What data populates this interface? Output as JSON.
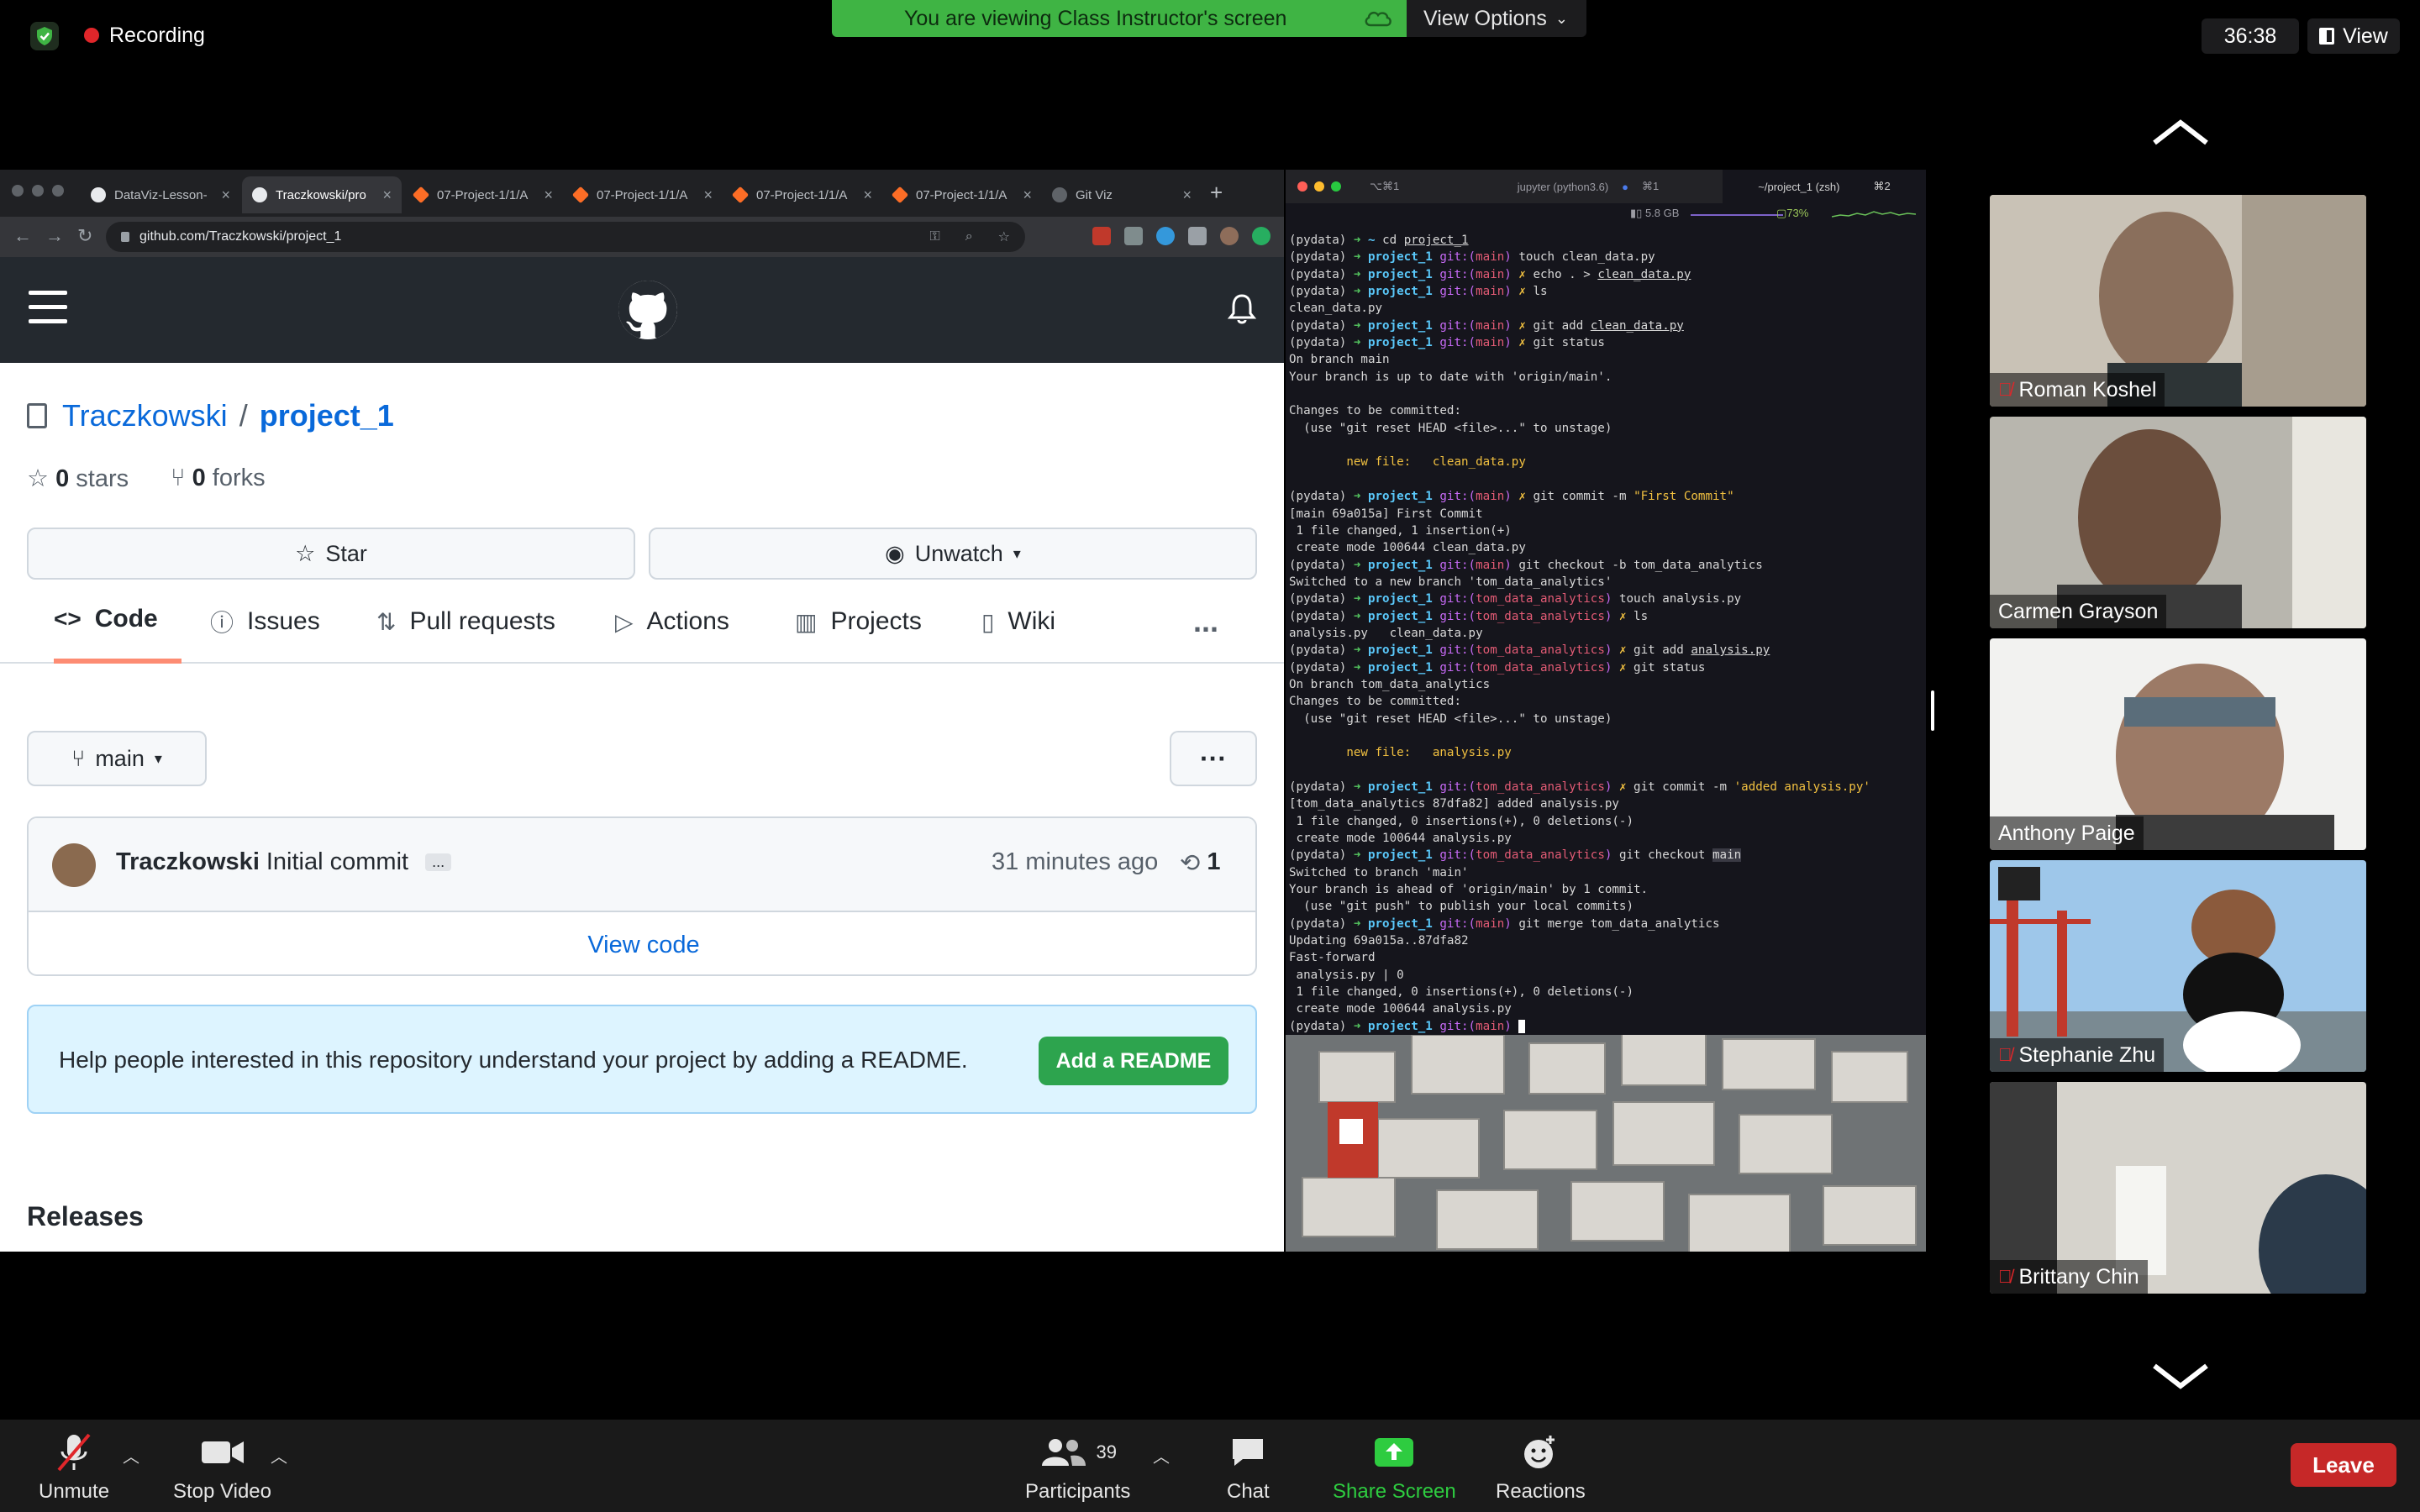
{
  "zoom": {
    "recording_label": "Recording",
    "viewing_banner": "You are viewing Class Instructor's screen",
    "view_options_label": "View Options",
    "timer": "36:38",
    "view_label": "View",
    "bottom": {
      "unmute": "Unmute",
      "stop_video": "Stop Video",
      "participants": "Participants",
      "participants_count": "39",
      "chat": "Chat",
      "share_screen": "Share Screen",
      "reactions": "Reactions",
      "leave": "Leave"
    },
    "participants_list": [
      {
        "name": "Roman Koshel",
        "muted": true
      },
      {
        "name": "Carmen Grayson",
        "muted": false
      },
      {
        "name": "Anthony Paige",
        "muted": false
      },
      {
        "name": "Stephanie Zhu",
        "muted": true
      },
      {
        "name": "Brittany Chin",
        "muted": true
      }
    ]
  },
  "browser": {
    "tabs": [
      {
        "title": "DataViz-Lesson-",
        "favicon": "github-icon"
      },
      {
        "title": "Traczkowski/pro",
        "favicon": "github-icon"
      },
      {
        "title": "07-Project-1/1/A",
        "favicon": "gitlab-icon"
      },
      {
        "title": "07-Project-1/1/A",
        "favicon": "gitlab-icon"
      },
      {
        "title": "07-Project-1/1/A",
        "favicon": "gitlab-icon"
      },
      {
        "title": "07-Project-1/1/A",
        "favicon": "gitlab-icon"
      },
      {
        "title": "Git Viz",
        "favicon": "globe-icon"
      }
    ],
    "url": "github.com/Traczkowski/project_1"
  },
  "github": {
    "owner": "Traczkowski",
    "separator": "/",
    "repo": "project_1",
    "stars_count": "0",
    "stars_label": "stars",
    "forks_count": "0",
    "forks_label": "forks",
    "star_button": "Star",
    "unwatch_button": "Unwatch",
    "tabs": [
      "Code",
      "Issues",
      "Pull requests",
      "Actions",
      "Projects",
      "Wiki"
    ],
    "more": "...",
    "branch": "main",
    "commit_author": "Traczkowski",
    "commit_message": "Initial commit",
    "commit_ellipsis": "...",
    "commit_time": "31 minutes ago",
    "commit_count": "1",
    "view_code": "View code",
    "readme_text": "Help people interested in this repository understand your project by adding a README.",
    "add_readme": "Add a README",
    "releases": "Releases"
  },
  "terminal": {
    "tab1": "⌥⌘1",
    "tab_jupyter": "jupyter (python3.6)",
    "tab_jupyter_key": "⌘1",
    "tab_project": "~/project_1 (zsh)",
    "tab_project_key": "⌘2",
    "status_mem": "5.8 GB",
    "status_battery": "73%",
    "env": "(pydata)",
    "lines": [
      {
        "t": "cmd",
        "dir": "~",
        "git": "",
        "br": "",
        "dirty": false,
        "cmd": "cd ",
        "arg": "project_1"
      },
      {
        "t": "cmd",
        "dir": "project_1",
        "git": "git:(",
        "br": "main",
        "dirty": false,
        "cmd": "touch clean_data.py",
        "arg": ""
      },
      {
        "t": "cmd",
        "dir": "project_1",
        "git": "git:(",
        "br": "main",
        "dirty": true,
        "cmd": "echo . > ",
        "arg": "clean_data.py"
      },
      {
        "t": "cmd",
        "dir": "project_1",
        "git": "git:(",
        "br": "main",
        "dirty": true,
        "cmd": "ls",
        "arg": ""
      },
      {
        "t": "out",
        "text": "clean_data.py"
      },
      {
        "t": "cmd",
        "dir": "project_1",
        "git": "git:(",
        "br": "main",
        "dirty": true,
        "cmd": "git add ",
        "arg": "clean_data.py"
      },
      {
        "t": "cmd",
        "dir": "project_1",
        "git": "git:(",
        "br": "main",
        "dirty": true,
        "cmd": "git status",
        "arg": ""
      },
      {
        "t": "out",
        "text": "On branch main"
      },
      {
        "t": "out",
        "text": "Your branch is up to date with 'origin/main'."
      },
      {
        "t": "out",
        "text": ""
      },
      {
        "t": "out",
        "text": "Changes to be committed:"
      },
      {
        "t": "out",
        "text": "  (use \"git reset HEAD <file>...\" to unstage)"
      },
      {
        "t": "out",
        "text": ""
      },
      {
        "t": "new",
        "text": "        new file:   clean_data.py"
      },
      {
        "t": "out",
        "text": ""
      },
      {
        "t": "cmd",
        "dir": "project_1",
        "git": "git:(",
        "br": "main",
        "dirty": true,
        "cmd": "git commit -m ",
        "arg": "",
        "str": "\"First Commit\""
      },
      {
        "t": "out",
        "text": "[main 69a015a] First Commit"
      },
      {
        "t": "out",
        "text": " 1 file changed, 1 insertion(+)"
      },
      {
        "t": "out",
        "text": " create mode 100644 clean_data.py"
      },
      {
        "t": "cmd",
        "dir": "project_1",
        "git": "git:(",
        "br": "main",
        "dirty": false,
        "cmd": "git checkout -b tom_data_analytics",
        "arg": ""
      },
      {
        "t": "out",
        "text": "Switched to a new branch 'tom_data_analytics'"
      },
      {
        "t": "cmd",
        "dir": "project_1",
        "git": "git:(",
        "br": "tom_data_analytics",
        "dirty": false,
        "cmd": "touch analysis.py",
        "arg": ""
      },
      {
        "t": "cmd",
        "dir": "project_1",
        "git": "git:(",
        "br": "tom_data_analytics",
        "dirty": true,
        "cmd": "ls",
        "arg": ""
      },
      {
        "t": "out",
        "text": "analysis.py   clean_data.py"
      },
      {
        "t": "cmd",
        "dir": "project_1",
        "git": "git:(",
        "br": "tom_data_analytics",
        "dirty": true,
        "cmd": "git add ",
        "arg": "analysis.py"
      },
      {
        "t": "cmd",
        "dir": "project_1",
        "git": "git:(",
        "br": "tom_data_analytics",
        "dirty": true,
        "cmd": "git status",
        "arg": ""
      },
      {
        "t": "out",
        "text": "On branch tom_data_analytics"
      },
      {
        "t": "out",
        "text": "Changes to be committed:"
      },
      {
        "t": "out",
        "text": "  (use \"git reset HEAD <file>...\" to unstage)"
      },
      {
        "t": "out",
        "text": ""
      },
      {
        "t": "new",
        "text": "        new file:   analysis.py"
      },
      {
        "t": "out",
        "text": ""
      },
      {
        "t": "cmd",
        "dir": "project_1",
        "git": "git:(",
        "br": "tom_data_analytics",
        "dirty": true,
        "cmd": "git commit -m ",
        "arg": "",
        "str": "'added analysis.py'"
      },
      {
        "t": "out",
        "text": "[tom_data_analytics 87dfa82] added analysis.py"
      },
      {
        "t": "out",
        "text": " 1 file changed, 0 insertions(+), 0 deletions(-)"
      },
      {
        "t": "out",
        "text": " create mode 100644 analysis.py"
      },
      {
        "t": "cmd",
        "dir": "project_1",
        "git": "git:(",
        "br": "tom_data_analytics",
        "dirty": false,
        "cmd": "git checkout ",
        "arg": "",
        "hl": "main"
      },
      {
        "t": "out",
        "text": "Switched to branch 'main'"
      },
      {
        "t": "out",
        "text": "Your branch is ahead of 'origin/main' by 1 commit."
      },
      {
        "t": "out",
        "text": "  (use \"git push\" to publish your local commits)"
      },
      {
        "t": "cmd",
        "dir": "project_1",
        "git": "git:(",
        "br": "main",
        "dirty": false,
        "cmd": "git merge tom_data_analytics",
        "arg": ""
      },
      {
        "t": "out",
        "text": "Updating 69a015a..87dfa82"
      },
      {
        "t": "out",
        "text": "Fast-forward"
      },
      {
        "t": "out",
        "text": " analysis.py | 0"
      },
      {
        "t": "out",
        "text": " 1 file changed, 0 insertions(+), 0 deletions(-)"
      },
      {
        "t": "out",
        "text": " create mode 100644 analysis.py"
      },
      {
        "t": "cmd",
        "dir": "project_1",
        "git": "git:(",
        "br": "main",
        "dirty": false,
        "cmd": "",
        "arg": "",
        "cursor": true
      }
    ]
  },
  "colors": {
    "banner_green": "#3fb444",
    "github_blue": "#0969da",
    "readme_green": "#2da44e",
    "leave_red": "#c62828",
    "share_green": "#2ecc40"
  }
}
